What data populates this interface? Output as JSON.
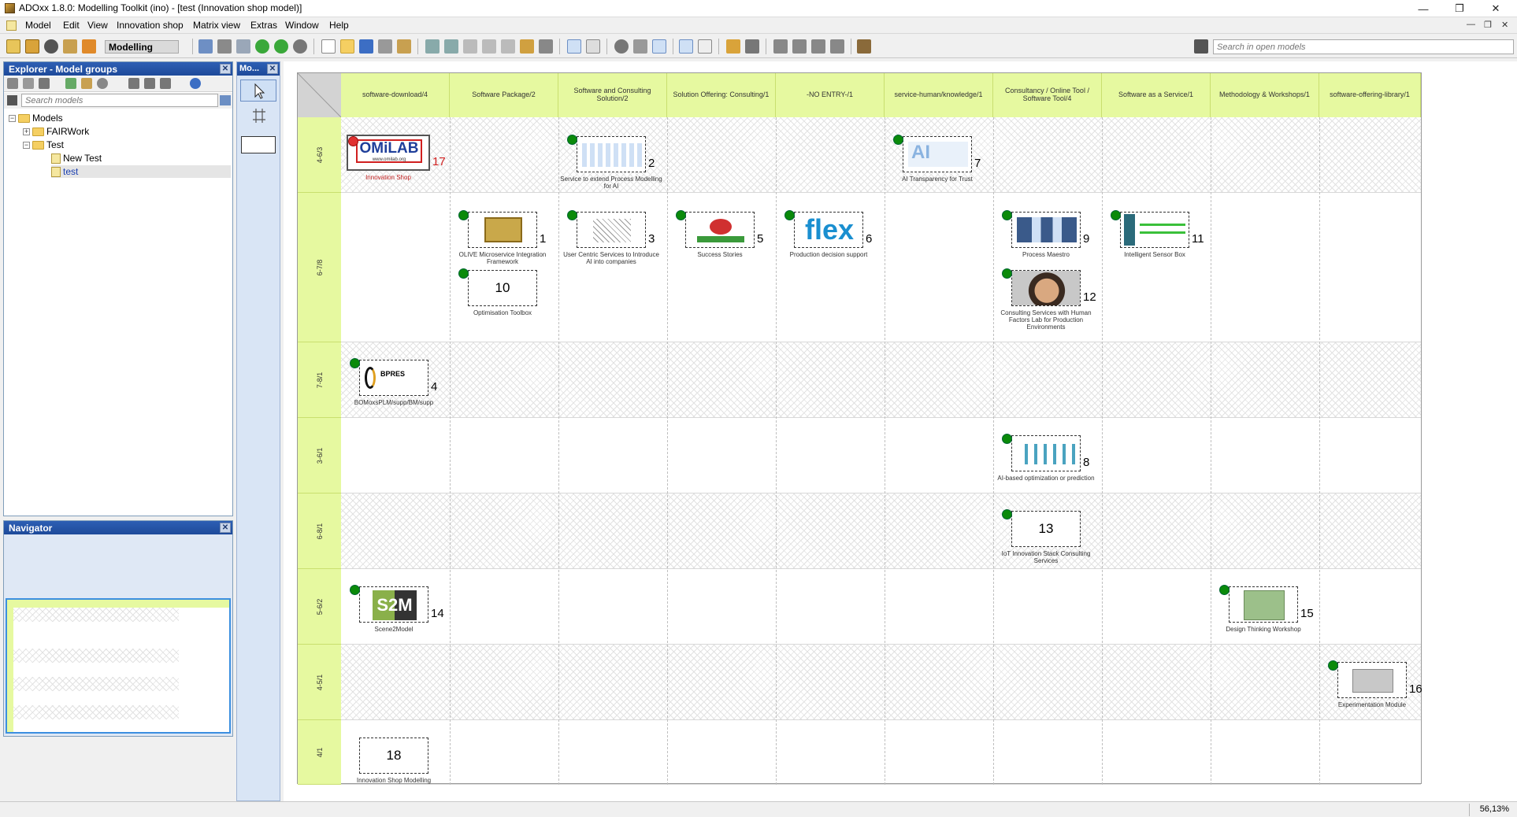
{
  "app": {
    "title": "ADOxx 1.8.0: Modelling Toolkit (ino) - [test (Innovation shop model)]"
  },
  "menu": [
    "Model",
    "Edit",
    "View",
    "Innovation shop",
    "Matrix view",
    "Extras",
    "Window",
    "Help"
  ],
  "toolbar": {
    "mode": "Modelling",
    "search_placeholder": "Search in open models"
  },
  "explorer": {
    "title": "Explorer - Model groups",
    "search_placeholder": "Search models",
    "tree": [
      {
        "label": "Models",
        "exp": "−"
      },
      {
        "label": "FAIRWork",
        "exp": "+"
      },
      {
        "label": "Test",
        "exp": "−"
      },
      {
        "label": "New Test"
      },
      {
        "label": "test"
      }
    ]
  },
  "navigator": {
    "title": "Navigator"
  },
  "modelling_bar": {
    "title": "Mo..."
  },
  "matrix": {
    "columns": [
      "software-download/4",
      "Software Package/2",
      "Software and Consulting Solution/2",
      "Solution Offering: Consulting/1",
      "-NO ENTRY-/1",
      "service-human/knowledge/1",
      "Consultancy / Online Tool / Software Tool/4",
      "Software as a Service/1",
      "Methodology & Workshops/1",
      "software-offering-library/1"
    ],
    "rows": [
      "4-6/3",
      "6-7/8",
      "7-8/1",
      "3-6/1",
      "6-8/1",
      "5-6/2",
      "4-5/1",
      "4/1"
    ],
    "items": [
      {
        "num": "17",
        "label": "Innovation Shop",
        "logo": "OMiLAB",
        "sub": "www.omilab.org"
      },
      {
        "num": "2",
        "label": "Service to extend Process Modelling for AI"
      },
      {
        "num": "7",
        "label": "AI Transparency for Trust",
        "logo": "AI"
      },
      {
        "num": "1",
        "label": "OLIVE Microservice Integration Framework"
      },
      {
        "num": "10",
        "label": "Optimisation Toolbox"
      },
      {
        "num": "3",
        "label": "User Centric Services to Introduce AI into companies"
      },
      {
        "num": "5",
        "label": "Success Stories"
      },
      {
        "num": "6",
        "label": "Production decision support",
        "logo": "flex"
      },
      {
        "num": "9",
        "label": "Process Maestro"
      },
      {
        "num": "12",
        "label": "Consulting Services with Human Factors Lab for Production Environments"
      },
      {
        "num": "11",
        "label": "Intelligent Sensor Box"
      },
      {
        "num": "4",
        "label": "BOMoxsPLM/supp/BM/supp",
        "logo": "BPRES"
      },
      {
        "num": "8",
        "label": "AI-based optimization or prediction"
      },
      {
        "num": "13",
        "label": "IoT Innovation Stack Consulting Services"
      },
      {
        "num": "14",
        "label": "Scene2Model",
        "logo": "S2M"
      },
      {
        "num": "15",
        "label": "Design Thinking Workshop"
      },
      {
        "num": "16",
        "label": "Experimentation Module"
      },
      {
        "num": "18",
        "label": "Innovation Shop Modelling"
      }
    ]
  },
  "status": {
    "zoom": "56,13%"
  },
  "colors": {
    "header": "#e6f9a0",
    "dot": "#0a8a0a",
    "panel_head": "#2d5fb4"
  }
}
